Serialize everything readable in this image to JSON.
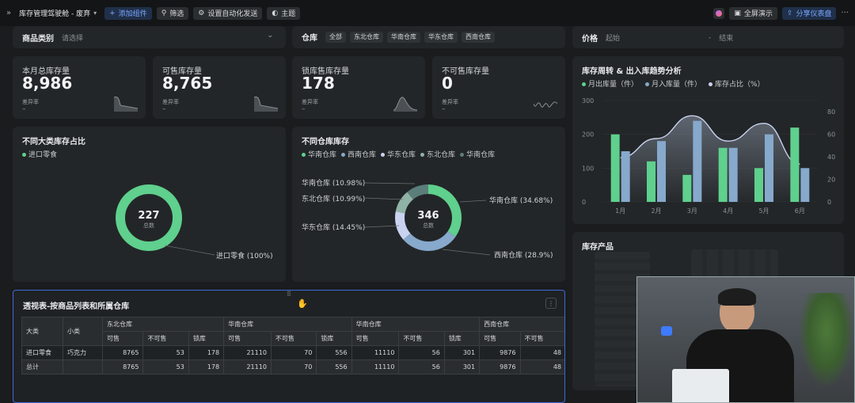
{
  "topbar": {
    "title": "库存管理驾驶舱 - 废弃",
    "add_component": "添加组件",
    "filter": "筛选",
    "auto_send": "设置自动化发送",
    "theme": "主题",
    "fullscreen": "全屏演示",
    "share": "分享仪表盘"
  },
  "filters": {
    "category_label": "商品类别",
    "category_placeholder": "请选择",
    "warehouse_label": "仓库",
    "warehouse_options": [
      "全部",
      "东北仓库",
      "华南仓库",
      "华东仓库",
      "西南仓库"
    ],
    "price_label": "价格",
    "price_start": "起始",
    "price_sep": "-",
    "price_end": "结束"
  },
  "kpis": [
    {
      "label": "本月总库存量",
      "value": "8,986",
      "sub": "差异率",
      "dash": "–"
    },
    {
      "label": "可售库存量",
      "value": "8,765",
      "sub": "差异率",
      "dash": "–"
    },
    {
      "label": "锁库售库存量",
      "value": "178",
      "sub": "差异率",
      "dash": "–"
    },
    {
      "label": "不可售库存量",
      "value": "0",
      "sub": "差异率",
      "dash": "–"
    }
  ],
  "donut1": {
    "title": "不同大类库存占比",
    "legend": "进口零食",
    "center_value": "227",
    "center_label": "总数",
    "label": "进口零食 (100%)"
  },
  "donut2": {
    "title": "不同仓库库存",
    "legend": [
      "华南仓库",
      "西南仓库",
      "华东仓库",
      "东北仓库",
      "华南仓库"
    ],
    "center_value": "346",
    "center_label": "总数",
    "labels": {
      "south": "华南仓库 (34.68%)",
      "southwest": "西南仓库 (28.9%)",
      "east": "华东仓库 (14.45%)",
      "northeast": "东北仓库 (10.99%)",
      "south2": "华南仓库 (10.98%)"
    },
    "slices": [
      34.68,
      28.9,
      14.45,
      10.99,
      10.98
    ],
    "colors": [
      "#5fd08d",
      "#86a9cc",
      "#c9d3f0",
      "#8fb3a6",
      "#5b7e7a"
    ]
  },
  "trend": {
    "title": "库存周转 & 出入库趋势分析",
    "legend": [
      "月出库量（件）",
      "月入库量（件）",
      "库存占比（%）"
    ],
    "colors": [
      "#5fd08d",
      "#86a9cc",
      "#c9d3f0"
    ],
    "yticks_left": [
      "300",
      "200",
      "100",
      "0"
    ],
    "yticks_right": [
      "80",
      "60",
      "40",
      "20",
      "0"
    ]
  },
  "chart_data": {
    "type": "bar",
    "categories": [
      "1月",
      "2月",
      "3月",
      "4月",
      "5月",
      "6月"
    ],
    "series": [
      {
        "name": "月出库量（件）",
        "values": [
          200,
          120,
          80,
          160,
          100,
          220
        ]
      },
      {
        "name": "月入库量（件）",
        "values": [
          150,
          180,
          240,
          160,
          200,
          100
        ]
      },
      {
        "name": "库存占比（%）",
        "values": [
          35,
          50,
          68,
          48,
          62,
          30
        ]
      }
    ],
    "ylim": [
      0,
      300
    ],
    "y2lim": [
      0,
      80
    ]
  },
  "stock_products": {
    "title": "库存产品"
  },
  "pivot": {
    "title": "透视表-按商品列表和所属仓库",
    "headers": {
      "category": "大类",
      "subcategory": "小类"
    },
    "warehouses": [
      "东北仓库",
      "华南仓库",
      "华南仓库",
      "西南仓库"
    ],
    "subcols": [
      "可售",
      "不可售",
      "锁库"
    ],
    "rows": [
      {
        "category": "进口零食",
        "subcategory": "巧克力",
        "values": [
          "8765",
          "53",
          "178",
          "21110",
          "70",
          "556",
          "11110",
          "56",
          "301",
          "9876",
          "48"
        ]
      },
      {
        "category": "总计",
        "subcategory": "",
        "values": [
          "8765",
          "53",
          "178",
          "21110",
          "70",
          "556",
          "11110",
          "56",
          "301",
          "9876",
          "48"
        ]
      }
    ]
  }
}
